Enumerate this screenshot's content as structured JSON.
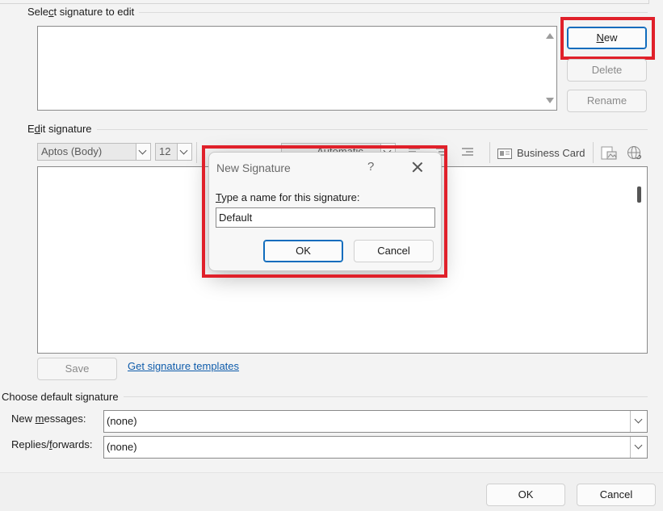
{
  "select_section": {
    "label_pre": "Sele",
    "label_ul": "c",
    "label_post": "t signature to edit"
  },
  "buttons": {
    "new_ul": "N",
    "new_rest": "ew",
    "delete": "Delete",
    "rename": "Rename"
  },
  "edit_section": {
    "label_pre": "E",
    "label_ul": "d",
    "label_post": "it signature"
  },
  "toolbar": {
    "font": "Aptos (Body)",
    "size": "12",
    "color": "Automatic",
    "business_card": "Business Card"
  },
  "save_button": "Save",
  "templates_link": "Get signature templates",
  "default_section": {
    "label": "Choose default signature",
    "new_messages_pre": "New ",
    "new_messages_ul": "m",
    "new_messages_post": "essages:",
    "new_messages_value": "(none)",
    "replies_pre": "Replies/",
    "replies_ul": "f",
    "replies_post": "orwards:",
    "replies_value": "(none)"
  },
  "footer": {
    "ok": "OK",
    "cancel": "Cancel"
  },
  "dialog": {
    "title": "New Signature",
    "help": "?",
    "prompt_ul": "T",
    "prompt_rest": "ype a name for this signature:",
    "input_value": "Default",
    "ok": "OK",
    "cancel": "Cancel"
  },
  "colors": {
    "highlight": "#e0202a",
    "link": "#0f5cab",
    "primary_border": "#0f6cbd"
  }
}
